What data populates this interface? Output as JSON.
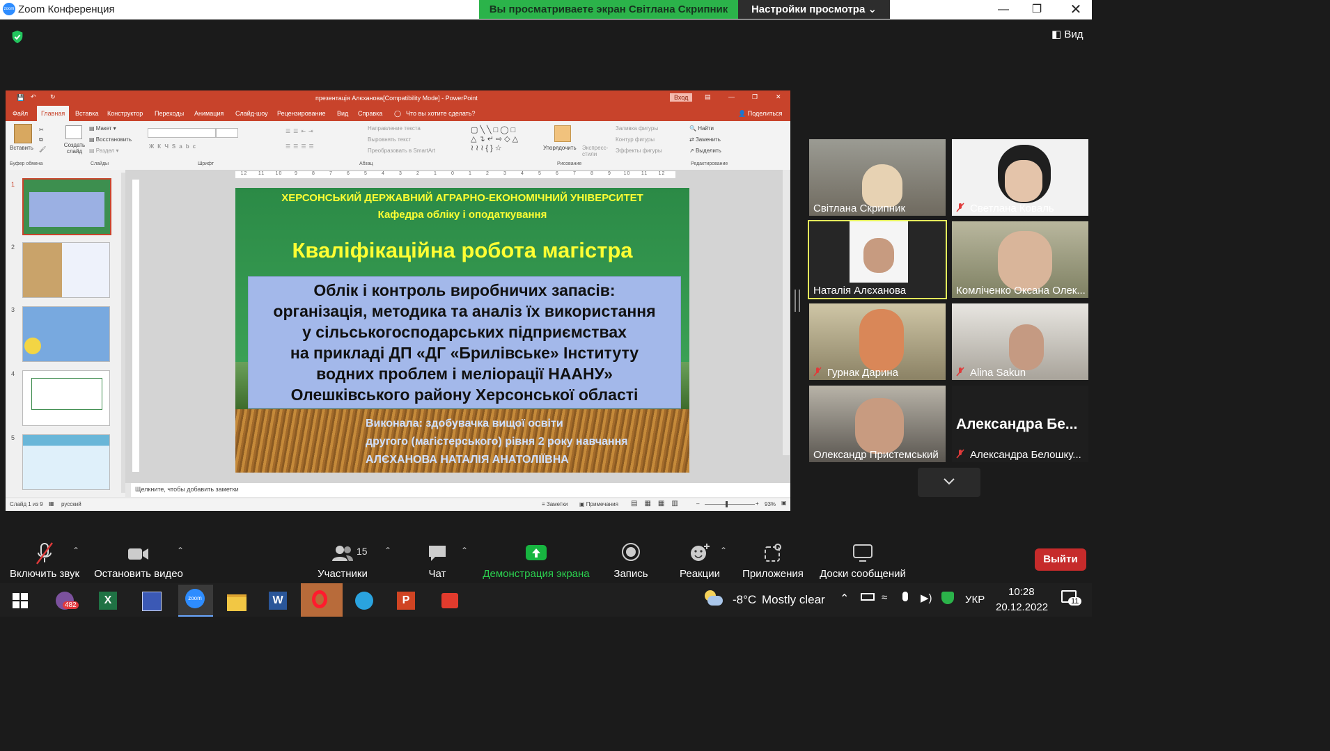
{
  "titlebar": {
    "app_title": "Zoom Конференция",
    "viewing_banner": "Вы просматриваете экран Світлана Скрипник",
    "view_options": "Настройки просмотра",
    "view_button": "Вид"
  },
  "ppt": {
    "window_title": "презентація Алєханова[Compatibility Mode]  -  PowerPoint",
    "signin": "Вход",
    "tabs": [
      "Файл",
      "Главная",
      "Вставка",
      "Конструктор",
      "Переходы",
      "Анимация",
      "Слайд-шоу",
      "Рецензирование",
      "Вид",
      "Справка"
    ],
    "tell_me": "Что вы хотите сделать?",
    "share": "Поделиться",
    "ribbon": {
      "paste": "Вставить",
      "clipboard": "Буфер обмена",
      "new_slide": "Создать слайд",
      "layout": "Макет",
      "reset": "Восстановить",
      "section": "Раздел",
      "slides": "Слайды",
      "font": "Шрифт",
      "paragraph": "Абзац",
      "text_direction": "Направление текста",
      "align_text": "Выровнять текст",
      "smartart": "Преобразовать в SmartArt",
      "arrange": "Упорядочить",
      "quick_styles": "Экспресс-стили",
      "shape_fill": "Заливка фигуры",
      "shape_outline": "Контур фигуры",
      "shape_effects": "Эффекты фигуры",
      "drawing": "Рисование",
      "find": "Найти",
      "replace": "Заменить",
      "select": "Выделить",
      "editing": "Редактирование"
    },
    "ruler": [
      "12",
      "11",
      "10",
      "9",
      "8",
      "7",
      "6",
      "5",
      "4",
      "3",
      "2",
      "1",
      "0",
      "1",
      "2",
      "3",
      "4",
      "5",
      "6",
      "7",
      "8",
      "9",
      "10",
      "11",
      "12"
    ],
    "thumb_numbers": [
      "1",
      "2",
      "3",
      "4",
      "5"
    ],
    "slide": {
      "university": "ХЕРСОНСЬКИЙ ДЕРЖАВНИЙ АГРАРНО-ЕКОНОМІЧНИЙ УНІВЕРСИТЕТ",
      "department": "Кафедра обліку і оподаткування",
      "heading": "Кваліфікаційна робота магістра",
      "topic": [
        "Облік і контроль виробничих запасів:",
        "організація, методика та аналіз їх використання",
        "у сільськогосподарських підприємствах",
        "на прикладі ДП «ДГ «Брилівське» Інституту",
        "водних проблем і меліорації НААНУ»",
        "Олешківського району Херсонської області"
      ],
      "author": [
        "Виконала: здобувачка вищої освіти",
        "другого (магістерського) рівня 2 року навчання",
        "АЛЄХАНОВА НАТАЛІЯ АНАТОЛІЇВНА"
      ]
    },
    "notes_placeholder": "Щелкните, чтобы добавить заметки",
    "status": {
      "slide_count": "Слайд 1 из 9",
      "language": "русский",
      "notes": "Заметки",
      "comments": "Примечания",
      "zoom": "93%"
    }
  },
  "participants": [
    {
      "name": "Світлана Скрипник",
      "muted": false
    },
    {
      "name": "Светлана Коваль",
      "muted": true
    },
    {
      "name": "Наталія Алєханова",
      "muted": false
    },
    {
      "name": "Комліченко Оксана Олек...",
      "muted": false
    },
    {
      "name": "Гурнак Дарина",
      "muted": true
    },
    {
      "name": "Alina Sakun",
      "muted": true
    },
    {
      "name": "Олександр Пристемський",
      "muted": false
    },
    {
      "name": "Александра Белошку...",
      "muted": true
    }
  ],
  "camera_off_label": "Александра  Бе...",
  "toolbar": {
    "unmute": "Включить звук",
    "stop_video": "Остановить видео",
    "participants": "Участники",
    "participants_count": "15",
    "chat": "Чат",
    "share_screen": "Демонстрация экрана",
    "record": "Запись",
    "reactions": "Реакции",
    "apps": "Приложения",
    "whiteboards": "Доски сообщений",
    "leave": "Выйти"
  },
  "taskbar": {
    "viber_badge": "482",
    "temperature": "-8°C",
    "weather": "Mostly clear",
    "language": "УКР",
    "time": "10:28",
    "date": "20.12.2022",
    "notifications": "11"
  },
  "colors": {
    "zoom_green": "#2bb34a",
    "leave_red": "#c62b2b",
    "ppt_red": "#c8432b",
    "active_speaker": "#e4ef5b"
  }
}
